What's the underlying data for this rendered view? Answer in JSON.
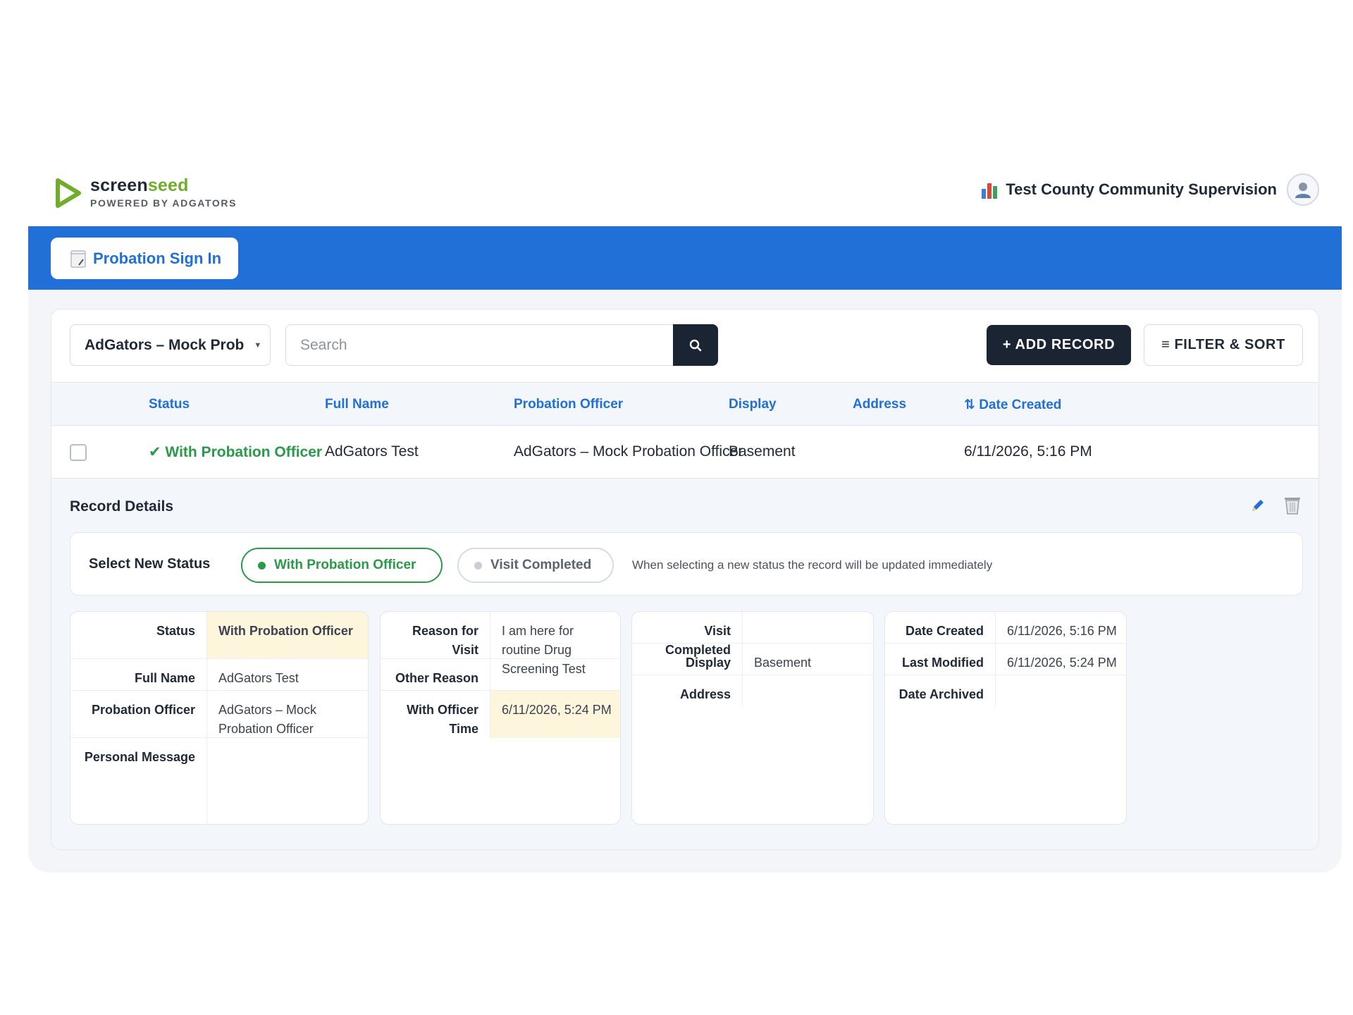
{
  "brand": {
    "name_main": "screen",
    "name_accent": "seed",
    "tagline": "POWERED BY ADGATORS",
    "accent_color": "#6fae2a"
  },
  "org": {
    "name": "Test County Community Supervision",
    "icon": "bar-chart-icon"
  },
  "nav": {
    "tab_label": "Probation Sign In",
    "tab_icon": "notepad-icon",
    "color": "#2070d8"
  },
  "toolbar": {
    "select_value": "AdGators – Mock Prob",
    "search_placeholder": "Search",
    "search_value": "",
    "add_label": "+ ADD RECORD",
    "filter_label": "≡ FILTER & SORT"
  },
  "table": {
    "headers": [
      "Status",
      "Full Name",
      "Probation Officer",
      "Display",
      "Address",
      "⇅ Date Created"
    ],
    "rows": [
      {
        "checked": false,
        "status": "✔ With Probation Officer",
        "full_name": "AdGators Test",
        "officer": "AdGators – Mock Probation Officer",
        "display": "Basement",
        "address": "",
        "date_created": "6/11/2026, 5:16 PM"
      }
    ]
  },
  "details": {
    "title": "Record Details",
    "select_status_label": "Select New Status",
    "status_options": [
      {
        "label": "With Probation Officer",
        "active": true
      },
      {
        "label": "Visit Completed",
        "active": false
      }
    ],
    "status_note": "When selecting a new status the record will be updated immediately",
    "panel1": [
      {
        "label": "Status",
        "value": "With Probation Officer"
      },
      {
        "label": "Full Name",
        "value": "AdGators Test"
      },
      {
        "label": "Probation Officer",
        "value": "AdGators – Mock Probation Officer"
      },
      {
        "label": "Personal Message",
        "value": ""
      }
    ],
    "panel2": [
      {
        "label": "Reason for Visit",
        "value": "I am here for routine Drug Screening Test"
      },
      {
        "label": "Other Reason",
        "value": ""
      },
      {
        "label": "With Officer Time",
        "value": "6/11/2026, 5:24 PM"
      }
    ],
    "panel3": [
      {
        "label": "Visit Completed",
        "value": ""
      },
      {
        "label": "Display",
        "value": "Basement"
      },
      {
        "label": "Address",
        "value": ""
      }
    ],
    "panel4": [
      {
        "label": "Date Created",
        "value": "6/11/2026, 5:16 PM"
      },
      {
        "label": "Last Modified",
        "value": "6/11/2026, 5:24 PM"
      },
      {
        "label": "Date Archived",
        "value": ""
      }
    ]
  },
  "colors": {
    "success": "#2b9a48",
    "dark": "#1a2433",
    "highlight": "#fdf5dc"
  }
}
